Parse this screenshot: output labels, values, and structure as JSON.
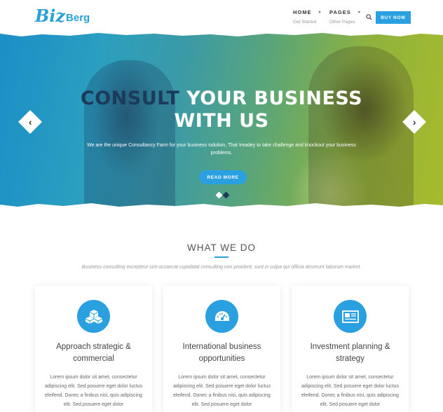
{
  "brand": {
    "mark": "Biz",
    "text": "Berg"
  },
  "nav": {
    "items": [
      {
        "label": "HOME",
        "sub": "Get Started"
      },
      {
        "label": "PAGES",
        "sub": "Other Pages"
      }
    ],
    "buy_label": "BUY NOW"
  },
  "hero": {
    "title_dark": "CONSULT",
    "title_rest": " YOUR BUSINESS",
    "title_line2": "WITH US",
    "description": "We are the unique Consultancy Farm for your business solution, That Ireadey to take challenge and knockout your business problems.",
    "button_label": "READ MORE",
    "prev_glyph": "‹",
    "next_glyph": "›"
  },
  "what_we_do": {
    "title": "WHAT WE DO",
    "subtitle": "Business consulting excepteur sint occaecat cupidatat consulting non proident, sunt in culpa qui officia deserunt laborum market.",
    "cards": [
      {
        "icon": "cubes-icon",
        "title": "Approach strategic & commercial",
        "text": "Lorem ipsum dolor sit amet, consectetur adipiscing elit. Sed posuere eget dolor luctus eleifend. Donec a finibus nisi, quis adipiscing elit. Sed posuere eget dolor"
      },
      {
        "icon": "dashboard-icon",
        "title": "International business opportunities",
        "text": "Lorem ipsum dolor sit amet, consectetur adipiscing elit. Sed posuere eget dolor luctus eleifend. Donec a finibus nisi, quis adipiscing elit. Sed posuere eget dolor"
      },
      {
        "icon": "newspaper-icon",
        "title": "Investment planning & strategy",
        "text": "Lorem ipsum dolor sit amet, consectetur adipiscing elit. Sed posuere eget dolor luctus eleifend. Donec a finibus nisi, quis adipiscing elit. Sed posuere eget dolor"
      }
    ]
  },
  "colors": {
    "accent": "#2aa0e0",
    "dark_title": "#1c3b5a"
  }
}
